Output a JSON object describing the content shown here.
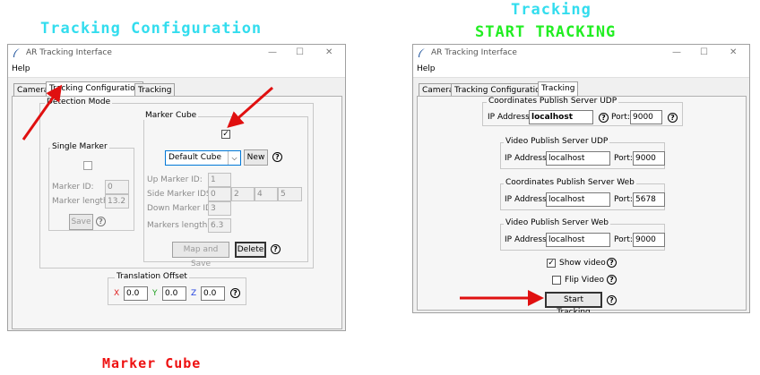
{
  "headings": {
    "left_top": "Tracking Configuration",
    "right_top_1": "Tracking",
    "right_top_2": "START TRACKING",
    "bottom": "Marker Cube"
  },
  "colors": {
    "cyan_heading": "#33ddee",
    "green_heading": "#22ee22",
    "red_heading": "#ee1111",
    "arrow": "#e01010"
  },
  "window": {
    "title": "AR Tracking Interface",
    "menu": "Help",
    "tabs": [
      "Camera",
      "Tracking Configuration",
      "Tracking"
    ]
  },
  "left": {
    "detection_mode": "Detection Mode",
    "single_marker": {
      "label": "Single Marker",
      "marker_id_label": "Marker ID:",
      "marker_id_value": "0",
      "marker_length_label": "Marker length:",
      "marker_length_value": "13.2",
      "save": "Save"
    },
    "marker_cube": {
      "label": "Marker Cube",
      "checked": "✓",
      "combo_value": "Default Cube",
      "new": "New",
      "up_label": "Up Marker ID:",
      "up_value": "1",
      "side_label": "Side Marker IDS:",
      "side_values": [
        "0",
        "2",
        "4",
        "5"
      ],
      "down_label": "Down Marker ID:",
      "down_value": "3",
      "length_label": "Markers length:",
      "length_value": "6.3",
      "map_save": "Map and Save",
      "delete": "Delete"
    },
    "translation": {
      "label": "Translation Offset",
      "x_label": "X",
      "x_value": "0.0",
      "y_label": "Y",
      "y_value": "0.0",
      "z_label": "Z",
      "z_value": "0.0"
    }
  },
  "right": {
    "udp_coords": {
      "label": "Coordinates Publish Server UDP",
      "ip_label": "IP Address:",
      "ip_value": "localhost",
      "port_label": "Port:",
      "port_value": "9000"
    },
    "udp_video": {
      "label": "Video Publish Server UDP",
      "ip_label": "IP Address:",
      "ip_value": "localhost",
      "port_label": "Port:",
      "port_value": "9000"
    },
    "web_coords": {
      "label": "Coordinates Publish Server Web",
      "ip_label": "IP Address:",
      "ip_value": "localhost",
      "port_label": "Port:",
      "port_value": "5678"
    },
    "web_video": {
      "label": "Video Publish Server Web",
      "ip_label": "IP Address:",
      "ip_value": "localhost",
      "port_label": "Port:",
      "port_value": "9000"
    },
    "show_video": "Show video",
    "show_video_check": "✓",
    "flip_video": "Flip Video",
    "start": "Start Tracking"
  },
  "icons": {
    "help": "?",
    "combo_arrow": "⌵",
    "minimize": "—",
    "maximize": "☐",
    "close": "✕"
  }
}
